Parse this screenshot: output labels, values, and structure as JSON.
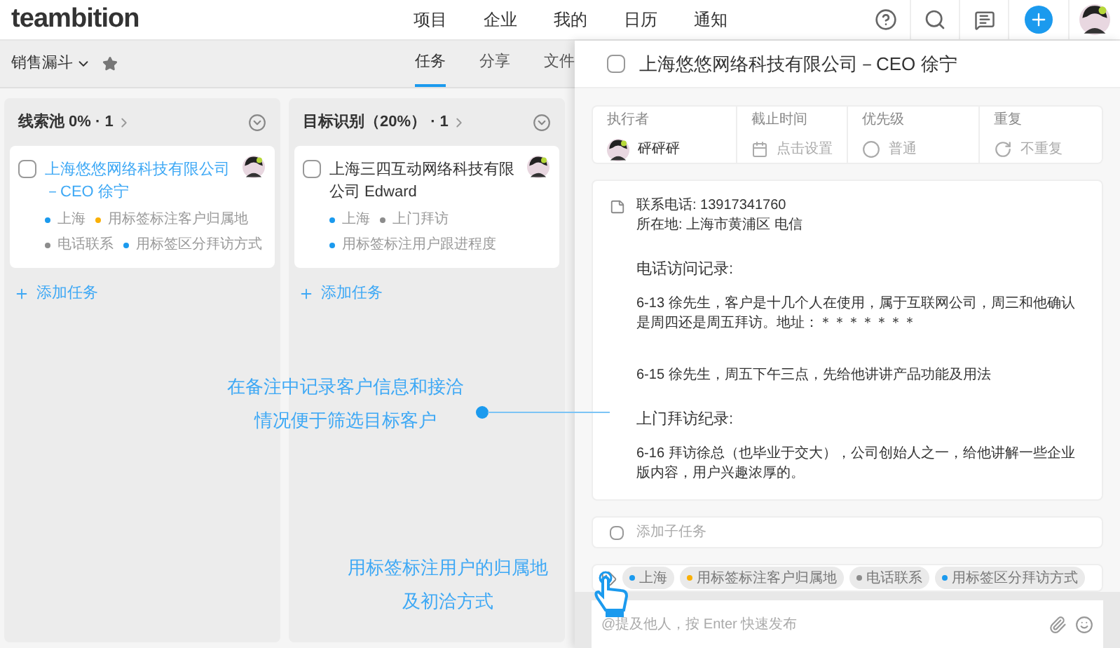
{
  "brand": "teambition",
  "nav": [
    {
      "label": "项目",
      "selected": false
    },
    {
      "label": "企业",
      "selected": false
    },
    {
      "label": "我的",
      "selected": false
    },
    {
      "label": "日历",
      "selected": false
    },
    {
      "label": "通知",
      "selected": false
    }
  ],
  "project": {
    "name": "销售漏斗",
    "starred": false
  },
  "tabs": [
    {
      "label": "任务",
      "selected": true
    },
    {
      "label": "分享",
      "selected": false
    },
    {
      "label": "文件",
      "selected": false
    }
  ],
  "columns": [
    {
      "title": "线索池 0% · 1",
      "cards": [
        {
          "title": "上海悠悠网络科技有限公司－CEO 徐宁",
          "link": true,
          "checked": false,
          "tags": [
            {
              "label": "上海",
              "color": "#1b9aee"
            },
            {
              "label": "用标签标注客户归属地",
              "color": "#fab005"
            },
            {
              "label": "电话联系",
              "color": "#8c8c8c"
            },
            {
              "label": "用标签区分拜访方式",
              "color": "#1b9aee"
            }
          ]
        }
      ],
      "add": "添加任务"
    },
    {
      "title": "目标识别（20%） · 1",
      "cards": [
        {
          "title": "上海三四互动网络科技有限公司 Edward",
          "link": false,
          "checked": false,
          "tags": [
            {
              "label": "上海",
              "color": "#1b9aee"
            },
            {
              "label": "上门拜访",
              "color": "#8c8c8c"
            },
            {
              "label": "用标签标注用户跟进程度",
              "color": "#1b9aee"
            }
          ]
        }
      ],
      "add": "添加任务"
    }
  ],
  "detail": {
    "title": "上海悠悠网络科技有限公司－CEO 徐宁",
    "checked": false,
    "fields": [
      {
        "kind": "user",
        "label": "执行者",
        "value": "砰砰砰"
      },
      {
        "kind": "date",
        "label": "截止时间",
        "placeholder": "点击设置"
      },
      {
        "kind": "priority",
        "label": "优先级",
        "value": "普通"
      },
      {
        "kind": "repeat",
        "label": "重复",
        "value": "不重复"
      }
    ],
    "note": {
      "contact": [
        "联系电话: 13917341760",
        "所在地: 上海市黄浦区 电信"
      ],
      "sections": [
        {
          "heading": "电话访问记录:",
          "entries": [
            "6-13 徐先生，客户是十几个人在使用，属于互联网公司，周三和他确认是周四还是周五拜访。地址：＊＊＊＊＊＊＊",
            "6-15 徐先生，周五下午三点，先给他讲讲产品功能及用法"
          ]
        },
        {
          "heading": "上门拜访纪录:",
          "entries": [
            "6-16 拜访徐总（也毕业于交大），公司创始人之一，给他讲解一些企业版内容，用户兴趣浓厚的。"
          ]
        }
      ]
    },
    "subtask": {
      "placeholder": "添加子任务"
    },
    "tags": [
      {
        "label": "上海",
        "color": "#1b9aee"
      },
      {
        "label": "用标签标注客户归属地",
        "color": "#fab005"
      },
      {
        "label": "电话联系",
        "color": "#8c8c8c"
      },
      {
        "label": "用标签区分拜访方式",
        "color": "#1b9aee"
      }
    ],
    "comment": {
      "placeholder": "@提及他人，按 Enter 快速发布"
    }
  },
  "annotations": [
    {
      "text": "在备注中记录客户信息和接洽情况便于筛选目标客户",
      "kind": "pointer"
    },
    {
      "text": "用标签标注用户的归属地及初洽方式",
      "kind": "cursor"
    }
  ]
}
